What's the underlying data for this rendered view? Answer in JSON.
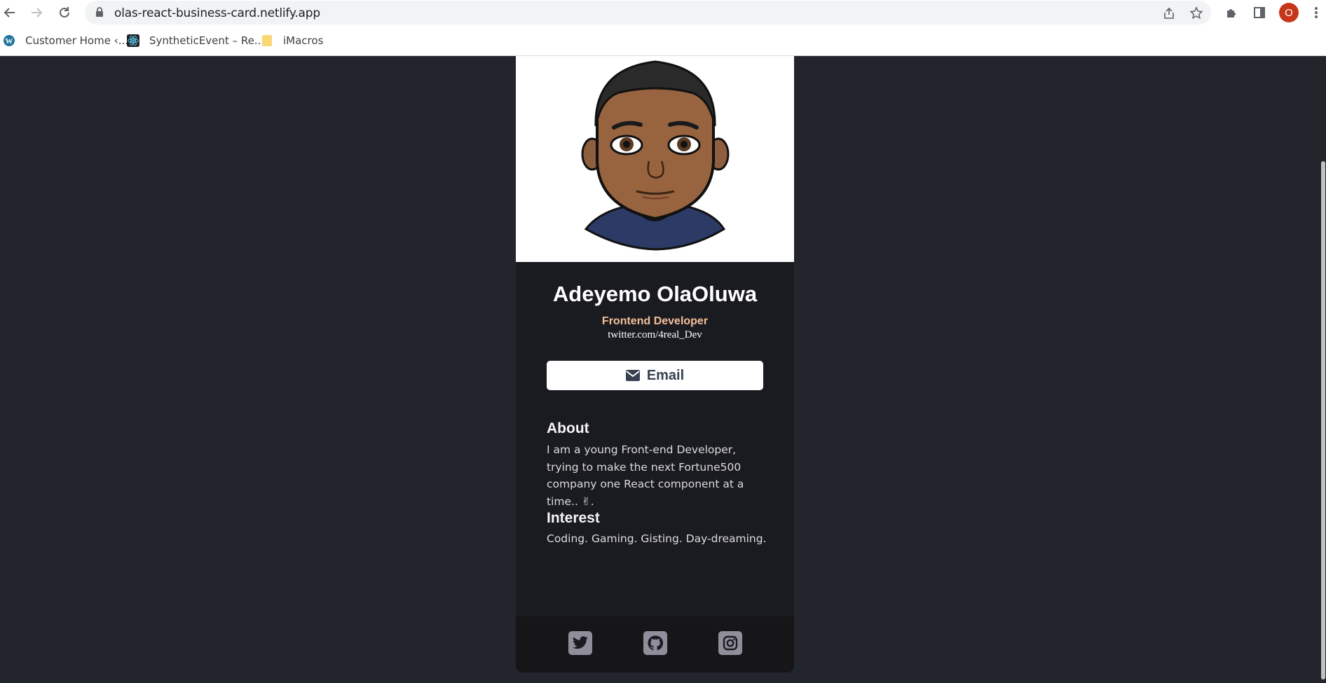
{
  "browser": {
    "url": "olas-react-business-card.netlify.app",
    "profile_initial": "O",
    "bookmarks": [
      {
        "label": "Customer Home ‹...",
        "icon": "wordpress-icon"
      },
      {
        "label": "SyntheticEvent – Re...",
        "icon": "react-icon"
      },
      {
        "label": "iMacros",
        "icon": "folder-icon"
      }
    ]
  },
  "card": {
    "name": "Adeyemo OlaOluwa",
    "role": "Frontend Developer",
    "handle": "twitter.com/4real_Dev",
    "email_label": "Email",
    "about_title": "About",
    "about_lines": [
      "I am a young Front-end Developer,",
      "trying to make the next Fortune500",
      "company one React component at a",
      "time.. ✌."
    ],
    "interest_title": "Interest",
    "interest_text": "Coding. Gaming. Gisting. Day-dreaming.",
    "socials": [
      "twitter-icon",
      "github-icon",
      "instagram-icon"
    ]
  },
  "colors": {
    "page_bg": "#23252c",
    "card_bg": "#1a1b21",
    "footer_bg": "#161619",
    "role_color": "#f3bf99",
    "social_icon_bg": "#918e9b"
  }
}
